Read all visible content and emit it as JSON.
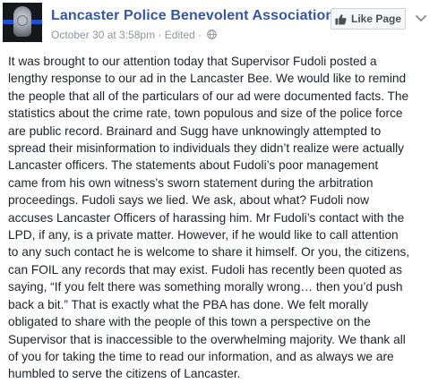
{
  "header": {
    "page_name": "Lancaster Police Benevolent Association",
    "timestamp": "October 30 at 3:58pm",
    "separator": "·",
    "edited": "Edited",
    "privacy_icon": "globe-icon",
    "like_button_label": "Like Page",
    "like_icon": "thumbs-up-icon",
    "menu_icon": "chevron-down-icon"
  },
  "post": {
    "lines": [
      "It was brought to our attention today that Supervisor Fudoli posted a",
      "lengthy response to our ad in the Lancaster Bee. We would like to remind",
      "the people that all of the particulars of our ad were documented facts. The",
      "statistics about the crime rate, town populous and size of the police force",
      "are public record. Brainard and Sugg have unknowingly attempted to",
      "spread their misinformation to individuals they didn’t realize were actually",
      "Lancaster officers. The statements about Fudoli’s poor management",
      "came from his own witness’s sworn statement during the arbitration",
      "proceedings. Fudoli says we lied. We ask, about what? Fudoli now",
      "accuses Lancaster Officers of harassing him. Mr Fudoli’s contact with the",
      "LPD, if any, is a private matter. However, if he would like to call attention",
      "to any such contact he is welcome to share it himself. Or you, the citizens,",
      "can FOIL any records that may exist. Fudoli has recently been quoted as",
      "saying, “If you felt there was something morally wrong… then you’d push",
      "back a bit.” That is exactly what the PBA has done. We felt morally",
      "obligated to share with the people of this town a perspective on the",
      "Supervisor that is inaccessible to the overwhelming majority. We thank all",
      "of you for taking the time to read our information, and as always we are",
      "humbled to serve the citizens of Lancaster."
    ]
  },
  "colors": {
    "link_blue": "#365899",
    "meta_gray": "#90949c",
    "text": "#1d2129",
    "button_bg": "#f6f7f9",
    "button_border": "#ced0d4",
    "avatar_bg": "#15171c",
    "avatar_stripe": "#1e4fd6"
  }
}
